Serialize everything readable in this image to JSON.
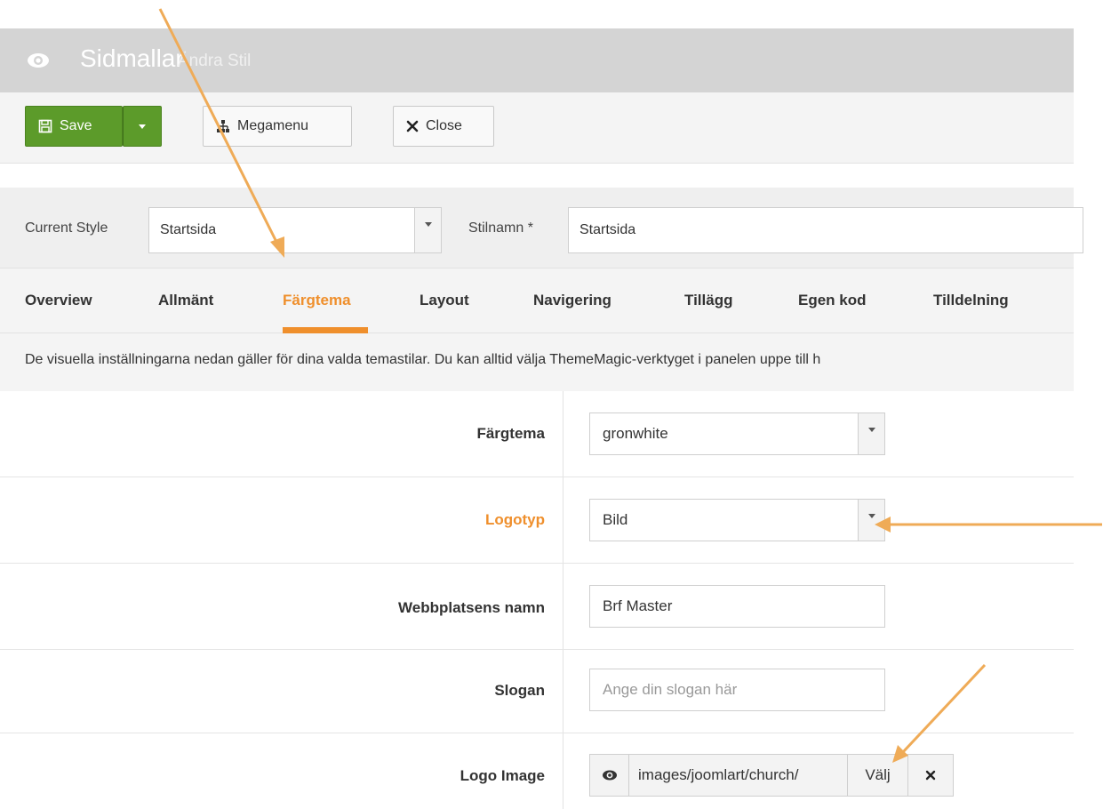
{
  "header": {
    "title": "Sidmallar",
    "subtitle": "Ändra Stil"
  },
  "toolbar": {
    "save_label": "Save",
    "megamenu_label": "Megamenu",
    "close_label": "Close"
  },
  "style_row": {
    "current_style_label": "Current Style",
    "current_style_value": "Startsida",
    "style_name_label": "Stilnamn *",
    "style_name_value": "Startsida"
  },
  "tabs": [
    {
      "label": "Overview",
      "active": false
    },
    {
      "label": "Allmänt",
      "active": false
    },
    {
      "label": "Färgtema",
      "active": true
    },
    {
      "label": "Layout",
      "active": false
    },
    {
      "label": "Navigering",
      "active": false
    },
    {
      "label": "Tillägg",
      "active": false
    },
    {
      "label": "Egen kod",
      "active": false
    },
    {
      "label": "Tilldelning",
      "active": false
    }
  ],
  "info_text": "De visuella inställningarna nedan gäller för dina valda temastilar. Du kan alltid välja ThemeMagic-verktyget i panelen uppe till h",
  "form": {
    "fargtema": {
      "label": "Färgtema",
      "value": "gronwhite"
    },
    "logotyp": {
      "label": "Logotyp",
      "value": "Bild"
    },
    "site_name": {
      "label": "Webbplatsens namn",
      "value": "Brf Master"
    },
    "slogan": {
      "label": "Slogan",
      "placeholder": "Ange din slogan här"
    },
    "logo_image": {
      "label": "Logo Image",
      "path": "images/joomlart/church/",
      "select_label": "Välj"
    }
  },
  "colors": {
    "accent": "#ef8f2c",
    "save_green": "#5c9b2a",
    "annotation_arrow": "#efab57"
  }
}
